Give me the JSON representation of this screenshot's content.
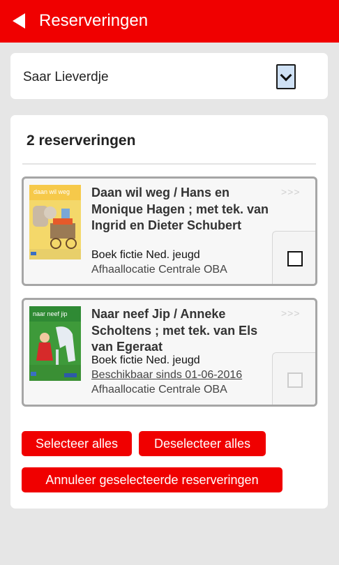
{
  "header": {
    "title": "Reserveringen"
  },
  "user_select": {
    "selected": "Saar Lieverdje"
  },
  "reservations": {
    "count_label": "2 reserveringen",
    "items": [
      {
        "title": "Daan wil weg / Hans en Monique Hagen ; met tek. van Ingrid en Dieter Schubert",
        "type": "Boek fictie Ned. jeugd",
        "location": "Afhaallocatie Centrale OBA",
        "more": ">>>",
        "cover_text": "daan wil weg",
        "checked": false,
        "enabled": true
      },
      {
        "title": "Naar neef Jip / Anneke Scholtens ; met tek. van Els van Egeraat",
        "type": "Boek fictie Ned. jeugd",
        "availability": "Beschikbaar sinds 01-06-2016",
        "location": "Afhaallocatie Centrale OBA",
        "more": ">>>",
        "cover_text": "naar neef jip",
        "checked": false,
        "enabled": false
      }
    ]
  },
  "buttons": {
    "select_all": "Selecteer alles",
    "deselect_all": "Deselecteer alles",
    "cancel_selected": "Annuleer geselecteerde reserveringen"
  },
  "colors": {
    "accent": "#f00000",
    "background": "#e6e6e6"
  }
}
